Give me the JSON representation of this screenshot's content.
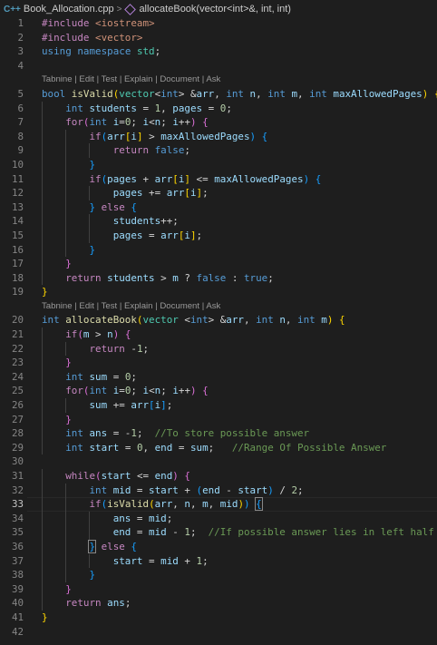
{
  "breadcrumb": {
    "file_icon": "C++",
    "file_name": "Book_Allocation.cpp",
    "separator": ">",
    "symbol_name": "allocateBook(vector<int>&, int, int)"
  },
  "code_lens": "Tabnine | Edit | Test | Explain | Document | Ask",
  "active_line": 33,
  "lines": [
    {
      "n": "1",
      "code": "#include <iostream>"
    },
    {
      "n": "2",
      "code": "#include <vector>"
    },
    {
      "n": "3",
      "code": "using namespace std;"
    },
    {
      "n": "4",
      "code": ""
    },
    {
      "lens": true
    },
    {
      "n": "5",
      "code": "bool isValid(vector<int> &arr, int n, int m, int maxAllowedPages) {"
    },
    {
      "n": "6",
      "code": "    int students = 1, pages = 0;"
    },
    {
      "n": "7",
      "code": "    for(int i=0; i<n; i++) {"
    },
    {
      "n": "8",
      "code": "        if(arr[i] > maxAllowedPages) {"
    },
    {
      "n": "9",
      "code": "            return false;"
    },
    {
      "n": "10",
      "code": "        }"
    },
    {
      "n": "11",
      "code": "        if(pages + arr[i] <= maxAllowedPages) {"
    },
    {
      "n": "12",
      "code": "            pages += arr[i];"
    },
    {
      "n": "13",
      "code": "        } else {"
    },
    {
      "n": "14",
      "code": "            students++;"
    },
    {
      "n": "15",
      "code": "            pages = arr[i];"
    },
    {
      "n": "16",
      "code": "        }"
    },
    {
      "n": "17",
      "code": "    }"
    },
    {
      "n": "18",
      "code": "    return students > m ? false : true;"
    },
    {
      "n": "19",
      "code": "}"
    },
    {
      "lens": true
    },
    {
      "n": "20",
      "code": "int allocateBook(vector <int> &arr, int n, int m) {"
    },
    {
      "n": "21",
      "code": "    if(m > n) {"
    },
    {
      "n": "22",
      "code": "        return -1;"
    },
    {
      "n": "23",
      "code": "    }"
    },
    {
      "n": "24",
      "code": "    int sum = 0;"
    },
    {
      "n": "25",
      "code": "    for(int i=0; i<n; i++) {"
    },
    {
      "n": "26",
      "code": "        sum += arr[i];"
    },
    {
      "n": "27",
      "code": "    }"
    },
    {
      "n": "28",
      "code": "    int ans = -1;  //To store possible answer"
    },
    {
      "n": "29",
      "code": "    int start = 0, end = sum;   //Range Of Possible Answer"
    },
    {
      "n": "30",
      "code": ""
    },
    {
      "n": "31",
      "code": "    while(start <= end) {"
    },
    {
      "n": "32",
      "code": "        int mid = start + (end - start) / 2;"
    },
    {
      "n": "33",
      "code": "        if(isValid(arr, n, m, mid)) {"
    },
    {
      "n": "34",
      "code": "            ans = mid;"
    },
    {
      "n": "35",
      "code": "            end = mid - 1;  //If possible answer lies in left half"
    },
    {
      "n": "36",
      "code": "        } else {"
    },
    {
      "n": "37",
      "code": "            start = mid + 1;"
    },
    {
      "n": "38",
      "code": "        }"
    },
    {
      "n": "39",
      "code": "    }"
    },
    {
      "n": "40",
      "code": "    return ans;"
    },
    {
      "n": "41",
      "code": "}"
    },
    {
      "n": "42",
      "code": ""
    }
  ]
}
